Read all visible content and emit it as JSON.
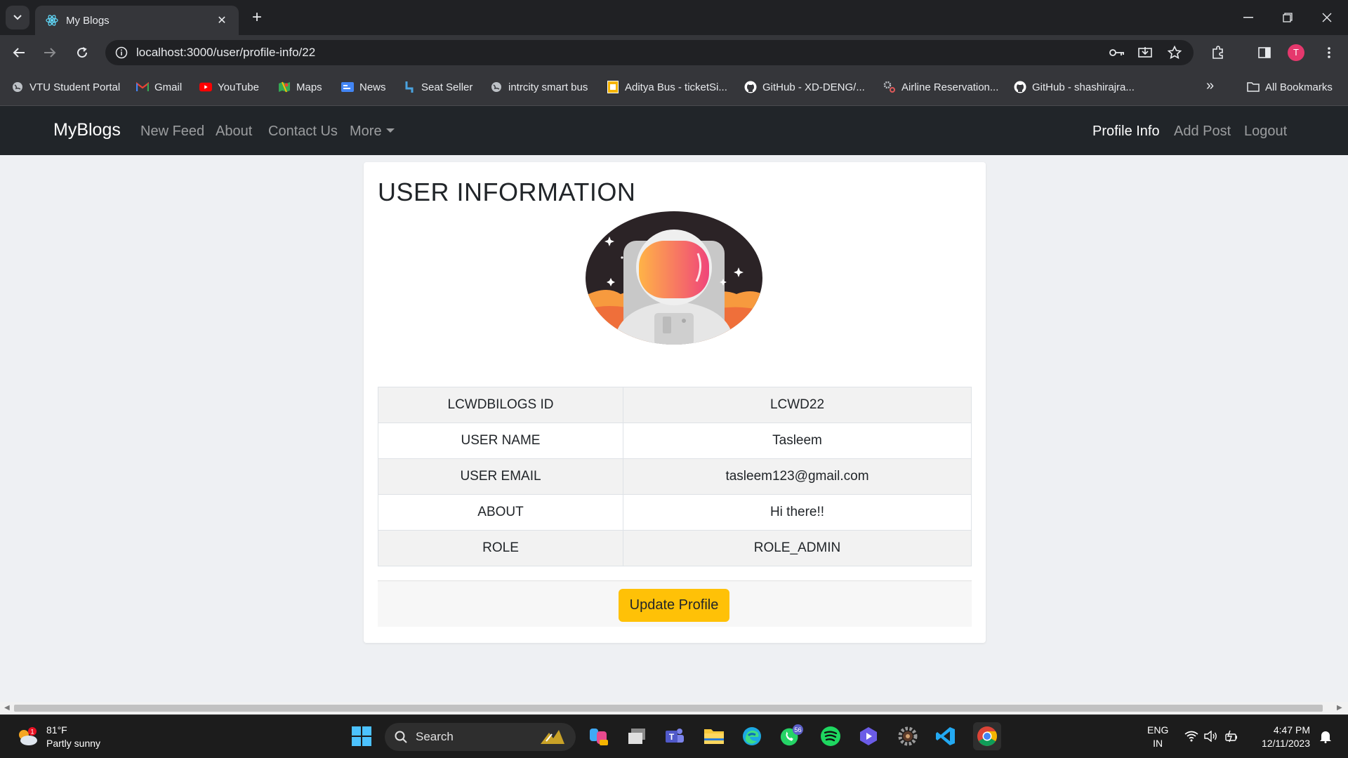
{
  "browser": {
    "tab_title": "My Blogs",
    "url": "localhost:3000/user/profile-info/22",
    "avatar_letter": "T",
    "bookmarks": [
      {
        "label": "VTU Student Portal",
        "icon": "globe-icon"
      },
      {
        "label": "Gmail",
        "icon": "gmail-icon"
      },
      {
        "label": "YouTube",
        "icon": "youtube-icon"
      },
      {
        "label": "Maps",
        "icon": "maps-icon"
      },
      {
        "label": "News",
        "icon": "news-icon"
      },
      {
        "label": "Seat Seller",
        "icon": "seat-icon"
      },
      {
        "label": "intrcity smart bus",
        "icon": "globe-icon"
      },
      {
        "label": "Aditya Bus - ticketSi...",
        "icon": "ticket-icon"
      },
      {
        "label": "GitHub - XD-DENG/...",
        "icon": "github-icon"
      },
      {
        "label": "Airline Reservation...",
        "icon": "gear-icon"
      },
      {
        "label": "GitHub - shashirajra...",
        "icon": "github-icon"
      }
    ],
    "all_bookmarks": "All Bookmarks",
    "overflow": "»"
  },
  "navbar": {
    "brand": "MyBlogs",
    "links": [
      "New Feed",
      "About",
      "Contact Us",
      "More"
    ],
    "right_links": [
      "Profile Info",
      "Add Post",
      "Logout"
    ]
  },
  "profile": {
    "heading": "USER INFORMATION",
    "rows": [
      {
        "label": "LCWDBILOGS ID",
        "value": "LCWD22"
      },
      {
        "label": "USER NAME",
        "value": "Tasleem"
      },
      {
        "label": "USER EMAIL",
        "value": "tasleem123@gmail.com"
      },
      {
        "label": "ABOUT",
        "value": "Hi there!!"
      },
      {
        "label": "ROLE",
        "value": "ROLE_ADMIN"
      }
    ],
    "update_button": "Update Profile"
  },
  "taskbar": {
    "weather_temp": "81°F",
    "weather_desc": "Partly sunny",
    "weather_badge": "1",
    "search_label": "Search",
    "whatsapp_badge": "56",
    "lang_top": "ENG",
    "lang_bottom": "IN",
    "time": "4:47 PM",
    "date": "12/11/2023"
  },
  "colors": {
    "navbar_bg": "#212529",
    "button_warning": "#ffc107",
    "page_bg": "#eef0f3"
  }
}
